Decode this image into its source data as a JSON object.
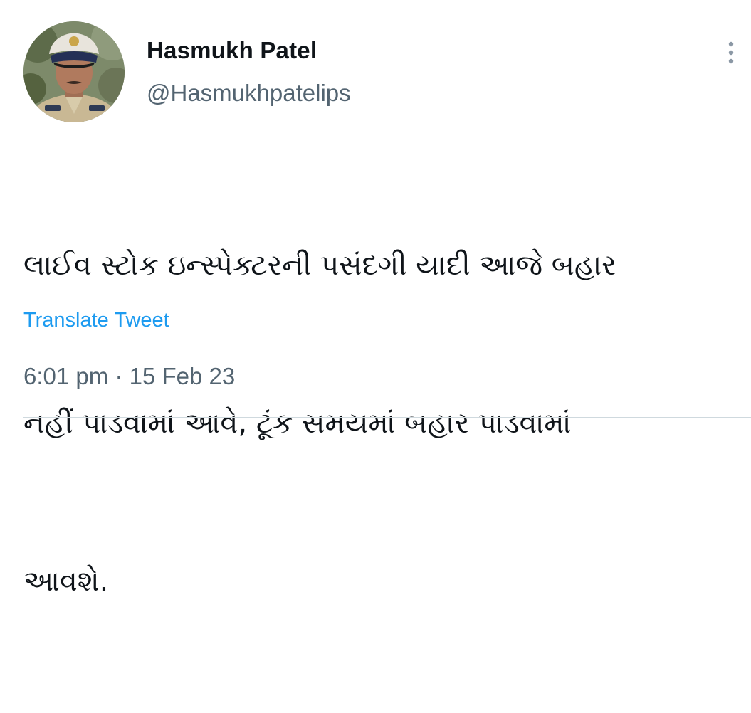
{
  "author": {
    "name": "Hasmukh Patel",
    "handle": "@Hasmukhpatelips",
    "avatar_icon": "profile-photo-police-officer"
  },
  "menu": {
    "icon": "more-vertical-icon"
  },
  "tweet": {
    "lines": [
      "લાઈવ સ્ટોક ઇન્સ્પેક્ટરની પસંદગી યાદી આજે બહાર",
      "નહીં પાડવામાં આવે, ટૂંક સમયમાં બહાર પાડવામાં",
      "આવશે."
    ],
    "translate_label": "Translate Tweet",
    "timestamp": "6:01 pm · 15 Feb 23"
  },
  "colors": {
    "text": "#0f1419",
    "secondary": "#536471",
    "link": "#1d9bf0",
    "divider": "#cfd9de"
  }
}
